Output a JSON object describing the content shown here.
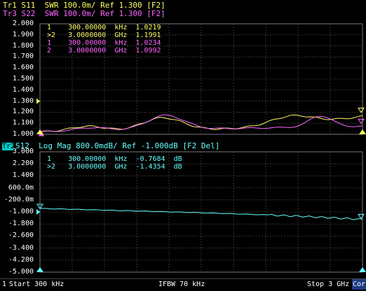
{
  "top_panel": {
    "line1": "Tr1 S11  SWR 100.0m/ Ref 1.300 [F2]",
    "line2": "Tr3 S22  SWR 100.0m/ Ref 1.300 [F2]",
    "ticks": [
      "2.000",
      "1.900",
      "1.800",
      "1.700",
      "1.600",
      "1.500",
      "1.400",
      "1.300",
      "1.200",
      "1.100",
      "1.000"
    ],
    "markers": [
      {
        "text": "1    300.00000  kHz  1.0219",
        "trace": "tr1"
      },
      {
        "text": ">2   3.0000000  GHz  1.1991",
        "trace": "tr1"
      },
      {
        "text": "1    300.00000  kHz  1.0234",
        "trace": "tr3"
      },
      {
        "text": "2    3.0000000  GHz  1.0992",
        "trace": "tr3"
      }
    ]
  },
  "bottom_panel": {
    "tab_label": "Tr2",
    "line": "S12  Log Mag 800.0mdB/ Ref -1.000dB [F2 Del]",
    "ticks": [
      "3.000",
      "2.200",
      "1.400",
      "600.0m",
      "-200.0m",
      "-1.000",
      "-1.800",
      "-2.600",
      "-3.400",
      "-4.200",
      "-5.000"
    ],
    "markers": [
      {
        "text": "1    300.00000  kHz  -0.7684  dB"
      },
      {
        "text": ">2   3.0000000  GHz  -1.4354  dB"
      }
    ]
  },
  "status": {
    "channel": "1",
    "start": "Start 300 kHz",
    "ifbw": "IFBW 70 kHz",
    "stop": "Stop 3 GHz",
    "cor": "Cor"
  },
  "colors": {
    "tr1": "#ffff66",
    "tr3": "#ff66ff",
    "tr2": "#66ffff"
  }
}
